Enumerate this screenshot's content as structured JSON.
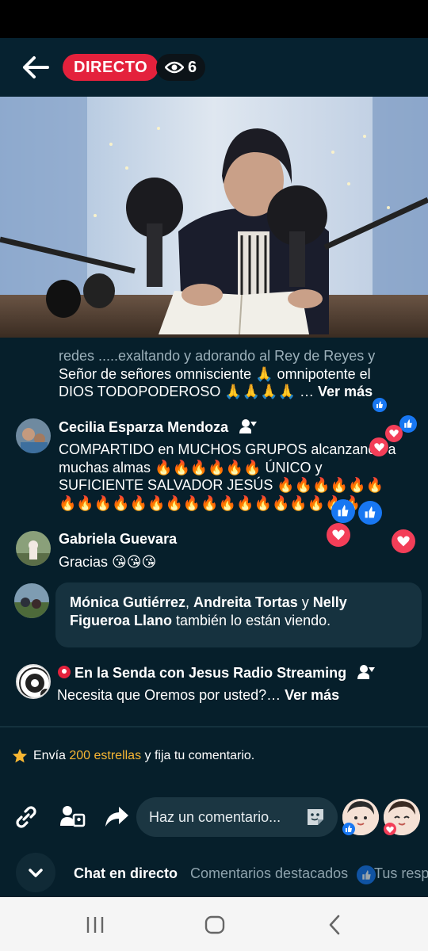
{
  "header": {
    "live_label": "DIRECTO",
    "viewer_count": "6"
  },
  "description": {
    "line1": "redes .....exaltando y adorando al Rey de Reyes y",
    "line2": "Señor de señores omnisciente 🙏 omnipotente el",
    "line3": "DIOS TODOPODEROSO 🙏🙏🙏🙏 … ",
    "see_more": "Ver más"
  },
  "comments": [
    {
      "name": "Cecilia Esparza Mendoza",
      "lines": [
        "COMPARTIDO en MUCHOS GRUPOS alcanzando a",
        "muchas almas 🔥🔥🔥🔥🔥🔥 ÚNICO y",
        "SUFICIENTE SALVADOR JESÚS 🔥🔥🔥🔥🔥🔥",
        "🔥🔥🔥🔥🔥🔥🔥🔥🔥🔥🔥🔥🔥🔥🔥🔥🔥"
      ]
    },
    {
      "name": "Gabriela Guevara",
      "text": "Gracias 😘😘😘"
    }
  ],
  "viewing_notice": {
    "name1": "Mónica Gutiérrez",
    "sep1": ", ",
    "name2": "Andreita Tortas",
    "sep2": " y ",
    "name3": "Nelly Figueroa Llano",
    "suffix": " también lo están viendo."
  },
  "page_comment": {
    "name": "En la Senda con Jesus Radio Streaming",
    "text": "Necesita que Oremos por usted?… ",
    "see_more": "Ver más"
  },
  "stars_promo": {
    "prefix": "Envía ",
    "count": "200 estrellas",
    "suffix": " y fija tu comentario."
  },
  "composer": {
    "placeholder": "Haz un comentario..."
  },
  "tabs": [
    {
      "label": "Chat en directo",
      "active": true
    },
    {
      "label": "Comentarios destacados",
      "active": false
    },
    {
      "label": "Tus resp",
      "active": false
    }
  ],
  "icons": [
    "back-arrow-icon",
    "eye-icon",
    "link-icon",
    "invite-icon",
    "share-icon",
    "sticker-icon",
    "chevron-down-icon",
    "recents-icon",
    "home-icon",
    "back-nav-icon"
  ],
  "colors": {
    "background": "#061f2b",
    "live": "#e4213c",
    "stars": "#f7b733",
    "like": "#1877f2",
    "love": "#f33e58"
  }
}
